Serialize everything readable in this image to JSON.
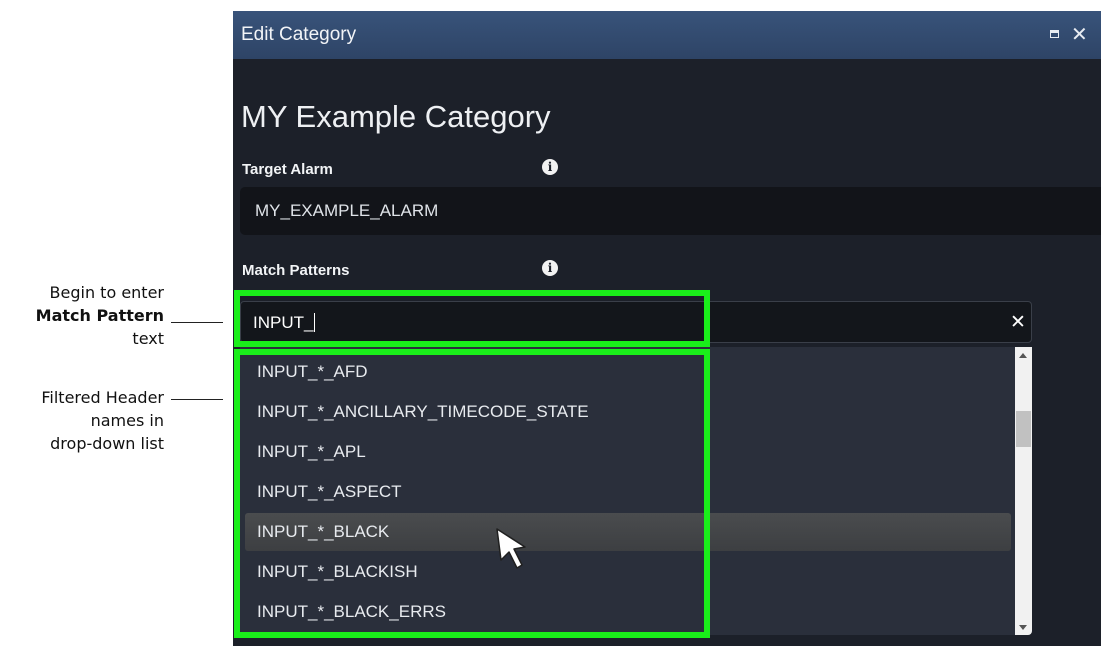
{
  "annotations": {
    "callout_1": {
      "line_1": "Begin to enter",
      "line_2": "Match Pattern",
      "line_3": "text"
    },
    "callout_2": {
      "line_1": "Filtered Header",
      "line_2": "names in",
      "line_3": "drop-down list"
    }
  },
  "dialog": {
    "title": "Edit Category",
    "maximize_icon": "maximize-icon",
    "close_icon": "close-icon",
    "heading": "MY Example Category",
    "target_alarm": {
      "label": "Target Alarm",
      "info_icon": "info-icon",
      "value": "MY_EXAMPLE_ALARM"
    },
    "match_patterns": {
      "label": "Match Patterns",
      "info_icon": "info-icon",
      "input_value": "INPUT_",
      "clear_icon": "clear-icon",
      "options": [
        "INPUT_*_AFD",
        "INPUT_*_ANCILLARY_TIMECODE_STATE",
        "INPUT_*_APL",
        "INPUT_*_ASPECT",
        "INPUT_*_BLACK",
        "INPUT_*_BLACKISH",
        "INPUT_*_BLACK_ERRS"
      ],
      "highlighted_option": "INPUT_*_BLACK"
    }
  },
  "colors": {
    "highlight_box": "#1aee1a",
    "titlebar": "#2e4466",
    "dialog_background": "#1c2029",
    "dropdown_background": "#2a2f3b"
  }
}
